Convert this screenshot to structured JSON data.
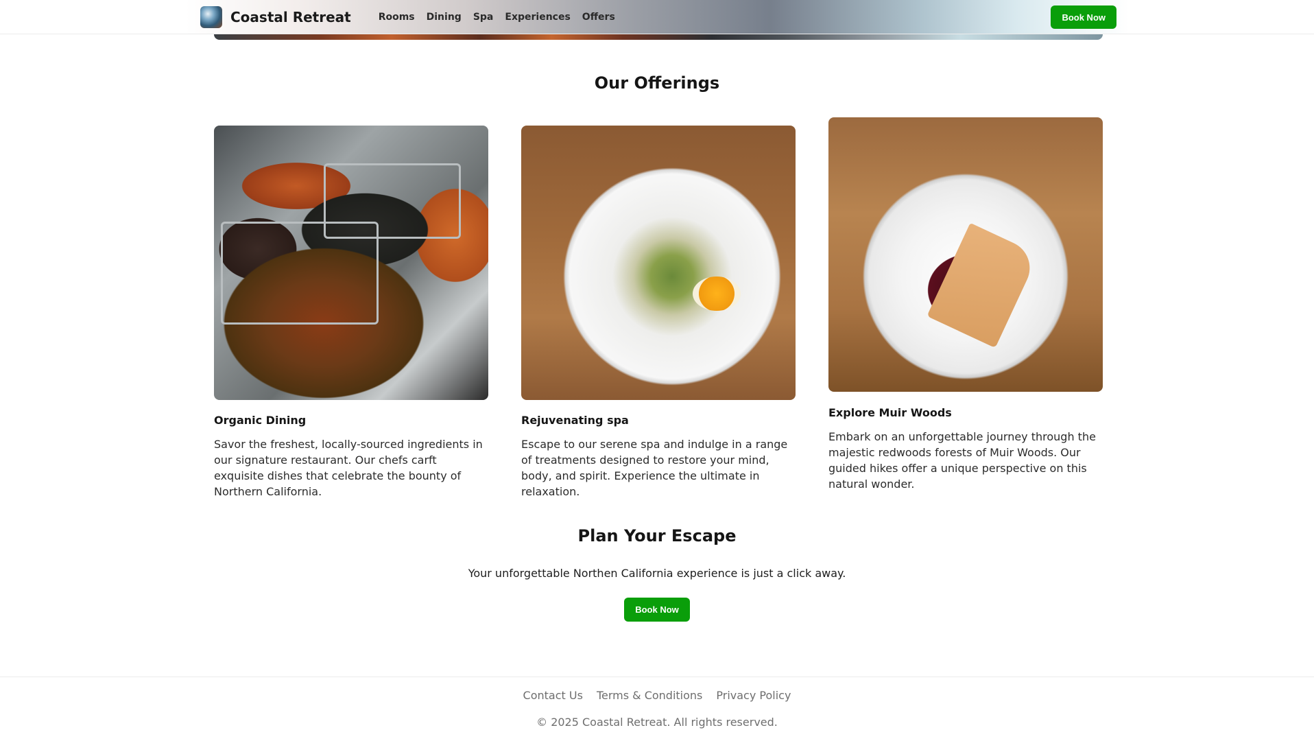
{
  "header": {
    "brand": "Coastal Retreat",
    "nav": [
      "Rooms",
      "Dining",
      "Spa",
      "Experiences",
      "Offers"
    ],
    "book_label": "Book Now"
  },
  "offerings": {
    "title": "Our Offerings",
    "cards": [
      {
        "title": "Organic Dining",
        "text": "Savor the freshest, locally-sourced ingredients in our signature restaurant. Our chefs carft exquisite dishes that celebrate the bounty of Northern California."
      },
      {
        "title": "Rejuvenating spa",
        "text": "Escape to our serene spa and indulge in a range of treatments designed to restore your mind, body, and spirit. Experience the ultimate in relaxation."
      },
      {
        "title": "Explore Muir Woods",
        "text": "Embark on an unforgettable journey through the majestic redwoods forests of Muir Woods. Our guided hikes offer a unique perspective on this natural wonder."
      }
    ]
  },
  "escape": {
    "title": "Plan Your Escape",
    "text": "Your unforgettable Northen California experience is just a click away.",
    "button_label": "Book Now"
  },
  "footer": {
    "links": [
      "Contact Us",
      "Terms & Conditions",
      "Privacy Policy"
    ],
    "copyright": "© 2025 Coastal Retreat. All rights reserved."
  },
  "colors": {
    "accent": "#0a9e0a",
    "text": "#141414",
    "muted": "#6e6e6e"
  }
}
